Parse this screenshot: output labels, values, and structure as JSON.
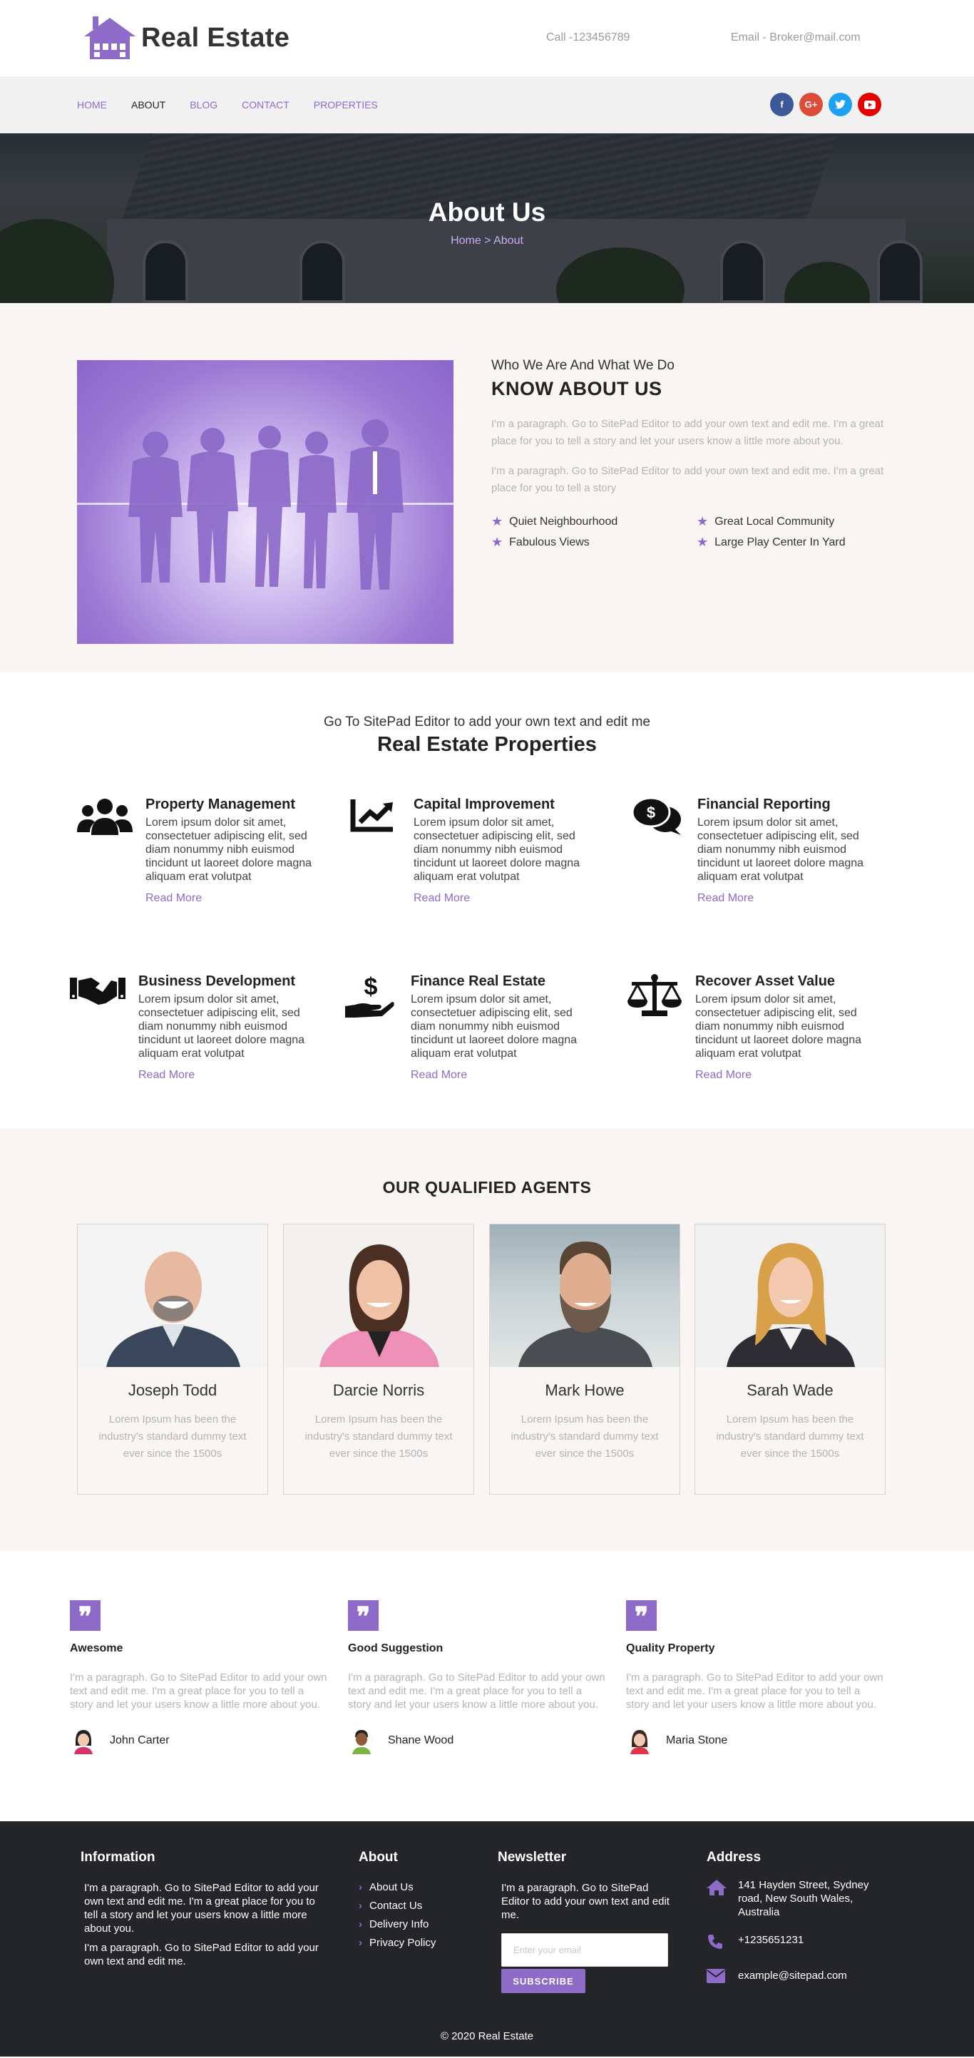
{
  "brand": {
    "name": "Real Estate",
    "accent": "#8e6bc9"
  },
  "header": {
    "call": "Call -123456789",
    "email": "Email - Broker@mail.com"
  },
  "nav": {
    "items": [
      "HOME",
      "ABOUT",
      "BLOG",
      "CONTACT",
      "PROPERTIES"
    ],
    "active": "ABOUT",
    "socials": [
      {
        "icon": "facebook-icon",
        "label": "f",
        "color": "#3b5998"
      },
      {
        "icon": "google-plus-icon",
        "label": "G+",
        "color": "#dd4b39"
      },
      {
        "icon": "twitter-icon",
        "label": "t",
        "color": "#1da1f2"
      },
      {
        "icon": "youtube-icon",
        "label": "▶",
        "color": "#e60000"
      }
    ]
  },
  "hero": {
    "title": "About Us",
    "crumb_home": "Home",
    "crumb_sep": " > ",
    "crumb_current": "About"
  },
  "about": {
    "subtitle": "Who We Are And What We Do",
    "title": "KNOW ABOUT US",
    "para1": "I'm a paragraph. Go to SitePad Editor to add your own text and edit me. I'm a great place for you to tell a story and let your users know a little more about you.",
    "para2": "I'm a paragraph. Go to SitePad Editor to add your own text and edit me. I'm a great place for you to tell a story",
    "features": [
      "Quiet Neighbourhood",
      "Great Local Community",
      "Fabulous Views",
      "Large Play Center In Yard"
    ]
  },
  "properties": {
    "subtitle": "Go To SitePad Editor to add your own text and edit me",
    "title": "Real Estate Properties",
    "items": [
      {
        "title": "Property Management",
        "icon": "users-icon",
        "desc": "Lorem ipsum dolor sit amet, consectetuer adipiscing elit, sed diam nonummy nibh euismod tincidunt ut laoreet dolore magna aliquam erat volutpat",
        "link": "Read More"
      },
      {
        "title": "Capital Improvement",
        "icon": "chart-line-icon",
        "desc": "Lorem ipsum dolor sit amet, consectetuer adipiscing elit, sed diam nonummy nibh euismod tincidunt ut laoreet dolore magna aliquam erat volutpat",
        "link": "Read More"
      },
      {
        "title": "Financial Reporting",
        "icon": "comments-dollar-icon",
        "desc": "Lorem ipsum dolor sit amet, consectetuer adipiscing elit, sed diam nonummy nibh euismod tincidunt ut laoreet dolore magna aliquam erat volutpat",
        "link": "Read More"
      },
      {
        "title": "Business Development",
        "icon": "handshake-icon",
        "desc": "Lorem ipsum dolor sit amet, consectetuer adipiscing elit, sed diam nonummy nibh euismod tincidunt ut laoreet dolore magna aliquam erat volutpat",
        "link": "Read More"
      },
      {
        "title": "Finance Real Estate",
        "icon": "hand-dollar-icon",
        "desc": "Lorem ipsum dolor sit amet, consectetuer adipiscing elit, sed diam nonummy nibh euismod tincidunt ut laoreet dolore magna aliquam erat volutpat",
        "link": "Read More"
      },
      {
        "title": "Recover Asset Value",
        "icon": "balance-scale-icon",
        "desc": "Lorem ipsum dolor sit amet, consectetuer adipiscing elit, sed diam nonummy nibh euismod tincidunt ut laoreet dolore magna aliquam erat volutpat",
        "link": "Read More"
      }
    ]
  },
  "agents": {
    "title": "OUR QUALIFIED AGENTS",
    "items": [
      {
        "name": "Joseph Todd",
        "desc": "Lorem Ipsum has been the industry's standard dummy text ever since the 1500s"
      },
      {
        "name": "Darcie Norris",
        "desc": "Lorem Ipsum has been the industry's standard dummy text ever since the 1500s"
      },
      {
        "name": "Mark Howe",
        "desc": "Lorem Ipsum has been the industry's standard dummy text ever since the 1500s"
      },
      {
        "name": "Sarah Wade",
        "desc": "Lorem Ipsum has been the industry's standard dummy text ever since the 1500s"
      }
    ]
  },
  "testimonials": [
    {
      "title": "Awesome",
      "text": "I'm a paragraph. Go to SitePad Editor to add your own text and edit me. I'm a great place for you to tell a story and let your users know a little more about you.",
      "name": "John Carter"
    },
    {
      "title": "Good Suggestion",
      "text": "I'm a paragraph. Go to SitePad Editor to add your own text and edit me. I'm a great place for you to tell a story and let your users know a little more about you.",
      "name": "Shane Wood"
    },
    {
      "title": "Quality Property",
      "text": "I'm a paragraph. Go to SitePad Editor to add your own text and edit me. I'm a great place for you to tell a story and let your users know a little more about you.",
      "name": "Maria Stone"
    }
  ],
  "footer": {
    "info_title": "Information",
    "info_p1": "I'm a paragraph. Go to SitePad Editor to add your own text and edit me. I'm a great place for you to tell a story and let your users know a little more about you.",
    "info_p2": "I'm a paragraph. Go to SitePad Editor to add your own text and edit me.",
    "about_title": "About",
    "about_links": [
      "About Us",
      "Contact Us",
      "Delivery Info",
      "Privacy Policy"
    ],
    "newsletter_title": "Newsletter",
    "newsletter_text": "I'm a paragraph. Go to SitePad Editor to add your own text and edit me.",
    "newsletter_placeholder": "Enter your email",
    "subscribe": "SUBSCRIBE",
    "address_title": "Address",
    "address": "141 Hayden Street, Sydney road, New South Wales, Australia",
    "phone": "+1235651231",
    "mail": "example@sitepad.com",
    "copyright": "© 2020 Real Estate"
  }
}
